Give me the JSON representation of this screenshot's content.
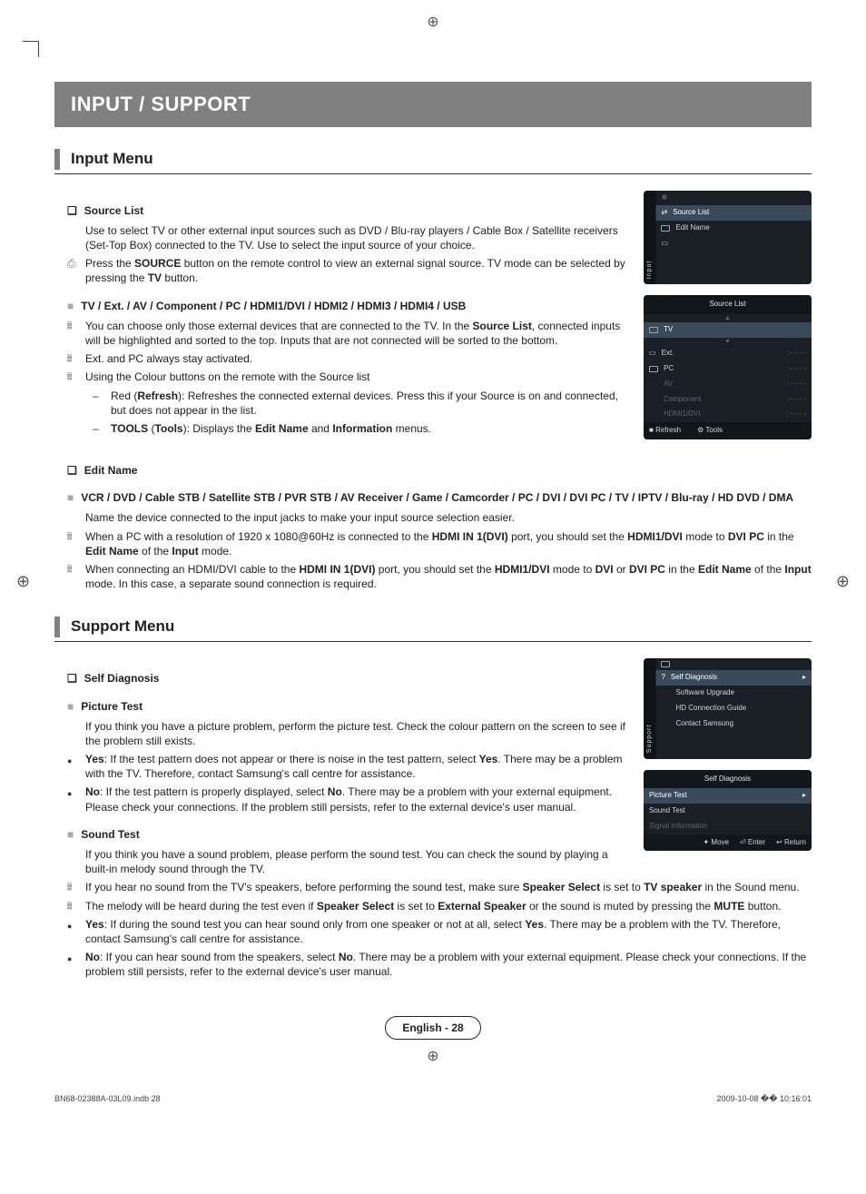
{
  "chapter_title": "INPUT / SUPPORT",
  "input_menu": {
    "heading": "Input Menu",
    "source_list": {
      "title": "Source List",
      "desc": "Use to select TV or other external input sources such as DVD / Blu-ray players / Cable Box / Satellite receivers (Set-Top Box) connected to the TV. Use to select the input source of your choice.",
      "remote_note_pre": "Press the ",
      "remote_note_bold1": "SOURCE",
      "remote_note_mid": " button on the remote control to view an external signal source. TV mode can be selected by pressing the ",
      "remote_note_bold2": "TV",
      "remote_note_post": " button."
    },
    "tv_ext": {
      "title": "TV / Ext. / AV / Component / PC / HDMI1/DVI / HDMI2 / HDMI3 / HDMI4 / USB",
      "note1_pre": "You can choose only those external devices that are connected to the TV. In the ",
      "note1_b1": "Source List",
      "note1_post": ", connected inputs will be highlighted and sorted to the top. Inputs that are not connected will be sorted to the bottom.",
      "note2": "Ext. and PC always stay activated.",
      "note3": "Using the Colour buttons on the remote with the Source list",
      "dash_red_pre": "Red (",
      "dash_red_b": "Refresh",
      "dash_red_post": "): Refreshes the connected external devices. Press this if your Source is on and connected, but does not appear in the list.",
      "dash_tools_b1": "TOOLS",
      "dash_tools_mid1": " (",
      "dash_tools_b2": "Tools",
      "dash_tools_mid2": "): Displays the ",
      "dash_tools_b3": "Edit Name",
      "dash_tools_mid3": " and ",
      "dash_tools_b4": "Information",
      "dash_tools_post": " menus."
    },
    "edit_name": {
      "title": "Edit Name",
      "devices": "VCR / DVD / Cable STB / Satellite STB / PVR STB / AV Receiver / Game / Camcorder / PC / DVI / DVI PC / TV / IPTV / Blu-ray / HD DVD / DMA",
      "desc": "Name the device connected to the input jacks to make your input source selection easier.",
      "note1_pre": "When a PC with a resolution of 1920 x 1080@60Hz is connected to the ",
      "note1_b1": "HDMI IN 1(DVI)",
      "note1_mid1": " port, you should set the ",
      "note1_b2": "HDMI1/DVI",
      "note1_mid2": " mode to ",
      "note1_b3": "DVI PC",
      "note1_mid3": " in the ",
      "note1_b4": "Edit Name",
      "note1_mid4": " of the ",
      "note1_b5": "Input",
      "note1_post": " mode.",
      "note2_pre": "When connecting an HDMI/DVI cable to the ",
      "note2_b1": "HDMI IN 1(DVI)",
      "note2_mid1": " port, you should set the ",
      "note2_b2": "HDMI1/DVI",
      "note2_mid2": " mode to ",
      "note2_b3": "DVI",
      "note2_mid3": " or ",
      "note2_b4": "DVI PC",
      "note2_mid4": " in the ",
      "note2_b5": "Edit Name",
      "note2_mid5": " of the ",
      "note2_b6": "Input",
      "note2_post": " mode. In this case, a separate sound connection is required."
    }
  },
  "support_menu": {
    "heading": "Support Menu",
    "self_diag_title": "Self Diagnosis",
    "picture_test": {
      "title": "Picture Test",
      "desc": "If you think you have a picture problem, perform the picture test. Check the colour pattern on the screen to see if the problem still exists.",
      "yes_b": "Yes",
      "yes_post": ": If the test pattern does not appear or there is noise in the test pattern, select ",
      "yes_b2": "Yes",
      "yes_post2": ". There may be a problem with the TV. Therefore, contact Samsung's call centre for assistance.",
      "no_b": "No",
      "no_post": ": If the test pattern is properly displayed, select ",
      "no_b2": "No",
      "no_post2": ". There may be a problem with your external equipment. Please check your connections. If the problem still persists, refer to the external device's user manual."
    },
    "sound_test": {
      "title": "Sound Test",
      "desc": "If you think you have a sound problem, please perform the sound test. You can check the sound by playing a built-in melody sound through the TV.",
      "note1_pre": "If you hear no sound from the TV's speakers, before performing the sound test, make sure ",
      "note1_b1": "Speaker Select",
      "note1_mid1": " is set to ",
      "note1_b2": "TV speaker",
      "note1_post": " in the Sound menu.",
      "note2_pre": "The melody will be heard during the test even if ",
      "note2_b1": "Speaker Select",
      "note2_mid1": " is set to ",
      "note2_b2": "External Speaker",
      "note2_mid2": " or the sound is muted by pressing the ",
      "note2_b3": "MUTE",
      "note2_post": " button.",
      "yes_b": "Yes",
      "yes_post": ": If during the sound test you can hear sound only from one speaker or not at all, select ",
      "yes_b2": "Yes",
      "yes_post2": ". There may be a problem with the TV. Therefore, contact Samsung's call centre for assistance.",
      "no_b": "No",
      "no_post": ": If you can hear sound from the speakers, select ",
      "no_b2": "No",
      "no_post2": ". There may be a problem with your external equipment. Please check your connections. If the problem still persists, refer to the external device's user manual."
    }
  },
  "osd1": {
    "side": "Input",
    "row_sel": "Source List",
    "row2": "Edit Name"
  },
  "osd2": {
    "header": "Source List",
    "tv": "TV",
    "ext": "Ext.",
    "pc": "PC",
    "av": "AV",
    "comp": "Component",
    "hdmi": "HDMI1/DVI",
    "dash": ": - - - -",
    "footer_refresh": "Refresh",
    "footer_tools": "Tools"
  },
  "osd3": {
    "side": "Support",
    "sel": "Self Diagnosis",
    "r2": "Software Upgrade",
    "r3": "HD Connection Guide",
    "r4": "Contact Samsung"
  },
  "osd4": {
    "header": "Self Diagnosis",
    "r1": "Picture Test",
    "r2": "Sound Test",
    "r3": "Signal Information",
    "move": "Move",
    "enter": "Enter",
    "return": "Return"
  },
  "footer": {
    "text": "English - 28"
  },
  "print": {
    "left": "BN68-02388A-03L09.indb   28",
    "right": "2009-10-08   �� 10:16:01"
  }
}
